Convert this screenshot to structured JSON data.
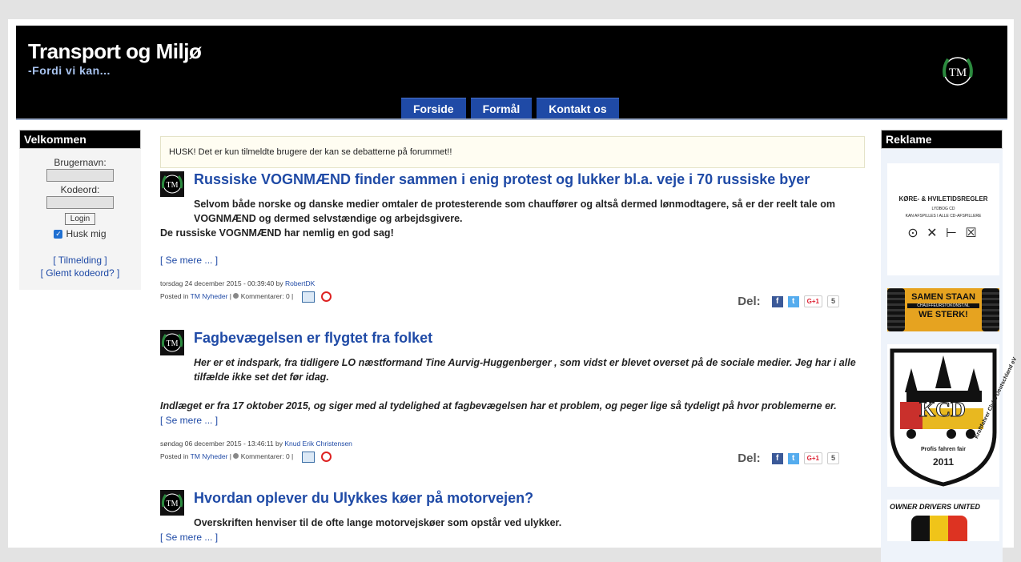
{
  "site": {
    "title": "Transport og Miljø",
    "slogan": "-Fordi vi kan..."
  },
  "nav": [
    "Forside",
    "Formål",
    "Kontakt os"
  ],
  "left": {
    "title": "Velkommen",
    "username_label": "Brugernavn:",
    "password_label": "Kodeord:",
    "login_button": "Login",
    "remember_label": "Husk mig",
    "register_link": "[ Tilmelding ]",
    "forgot_link": "[ Glemt kodeord? ]"
  },
  "right": {
    "title": "Reklame",
    "ad1": {
      "title": "KØRE- & HVILETIDSREGLER",
      "sub1": "LYDBOG CD",
      "sub2": "KAN AFSPILLES I ALLE CD-AFSPILLERE",
      "symbols": "⊙ ✕ ⊢ ☒"
    },
    "ad2": {
      "line1": "SAMEN STAAN",
      "site": "CHAUFFEURSTOKONST.NL",
      "line2": "WE STERK!"
    },
    "ad3": {
      "letters": "KCD",
      "arc": "Kraftfahrer Clubs Deutschland eV",
      "line": "Profis fahren fair",
      "year": "2011"
    },
    "ad4": {
      "title": "OWNER DRIVERS UNITED"
    }
  },
  "notice": "HUSK! Det er kun tilmeldte brugere der kan se debatterne på forummet!!",
  "articles": [
    {
      "title": "Russiske VOGNMÆND finder sammen i enig protest og lukker bl.a. veje i 70 russiske byer",
      "p1": "Selvom både norske og danske medier omtaler de protesterende som chauffører og altså dermed lønmodtagere, så er der reelt tale om VOGNMÆND og dermed selvstændige og arbejdsgivere.",
      "p2": "De russiske VOGNMÆND har nemlig en god sag!",
      "more": "[ Se mere ... ]",
      "date": "torsdag 24 december 2015 - 00:39:40 by",
      "author": "RobertDK",
      "posted": "Posted in",
      "category": "TM Nyheder",
      "comments": "Kommentarer: 0 |",
      "share_label": "Del:",
      "share_count": "5"
    },
    {
      "title": "Fagbevægelsen er flygtet fra folket",
      "p1": "Her er et indspark, fra tidligere LO næstformand Tine Aurvig-Huggenberger , som vidst er blevet overset på de sociale medier. Jeg har i alle tilfælde ikke set det før idag.",
      "p2": "Indlæget er fra 17 oktober 2015, og siger med al tydelighed at fagbevægelsen har et problem, og peger lige så tydeligt på hvor problemerne er.",
      "more": "[ Se mere ... ]",
      "date": "søndag 06 december 2015 - 13:46:11 by",
      "author": "Knud Erik Christensen",
      "posted": "Posted in",
      "category": "TM Nyheder",
      "comments": "Kommentarer: 0 |",
      "share_label": "Del:",
      "share_count": "5"
    },
    {
      "title": "Hvordan oplever du Ulykkes køer på motorvejen?",
      "p1": "Overskriften henviser til de ofte lange motorvejskøer som opstår ved ulykker.",
      "more": "[ Se mere ... ]"
    }
  ],
  "colors": {
    "header_bg": "#000000",
    "nav_bg": "#1f4aa6",
    "link": "#1f4aa6",
    "notice_bg": "#fffdf2"
  }
}
